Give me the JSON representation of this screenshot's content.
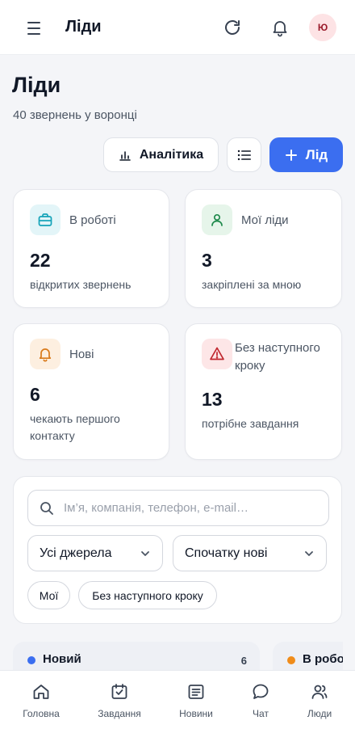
{
  "header": {
    "title": "Ліди",
    "avatar_initials": "Ю"
  },
  "page": {
    "title": "Ліди",
    "subtitle": "40 звернень у воронці"
  },
  "actions": {
    "analytics_label": "Аналітика",
    "add_label": "Лід"
  },
  "stats": [
    {
      "label": "В роботі",
      "value": "22",
      "desc": "відкритих звернень",
      "icon": "briefcase-icon",
      "color": "#14a3b8"
    },
    {
      "label": "Мої ліди",
      "value": "3",
      "desc": "закріплені за мною",
      "icon": "user-icon",
      "color": "#1f8a4c"
    },
    {
      "label": "Нові",
      "value": "6",
      "desc": "чекають першого контакту",
      "icon": "bell-icon",
      "color": "#d97a1a"
    },
    {
      "label": "Без наступного кроку",
      "value": "13",
      "desc": "потрібне завдання",
      "icon": "warning-icon",
      "color": "#c0262e"
    }
  ],
  "filters": {
    "search_placeholder": "Ім’я, компанія, телефон, e-mail…",
    "source_select": "Усі джерела",
    "sort_select": "Спочатку нові",
    "chips": [
      "Мої",
      "Без наступного кроку"
    ]
  },
  "columns": [
    {
      "name": "Новий",
      "count": "6",
      "color": "#3b6ef0"
    },
    {
      "name": "В робо",
      "color": "#f08c1a"
    }
  ],
  "bottom_nav": [
    {
      "label": "Головна",
      "icon": "home-icon"
    },
    {
      "label": "Завдання",
      "icon": "calendar-check-icon"
    },
    {
      "label": "Новини",
      "icon": "news-icon"
    },
    {
      "label": "Чат",
      "icon": "chat-icon"
    },
    {
      "label": "Люди",
      "icon": "people-icon"
    }
  ],
  "colors": {
    "accent": "#3b6ef0",
    "avatar_bg": "#fde3e5",
    "avatar_text": "#9b1c2c"
  }
}
